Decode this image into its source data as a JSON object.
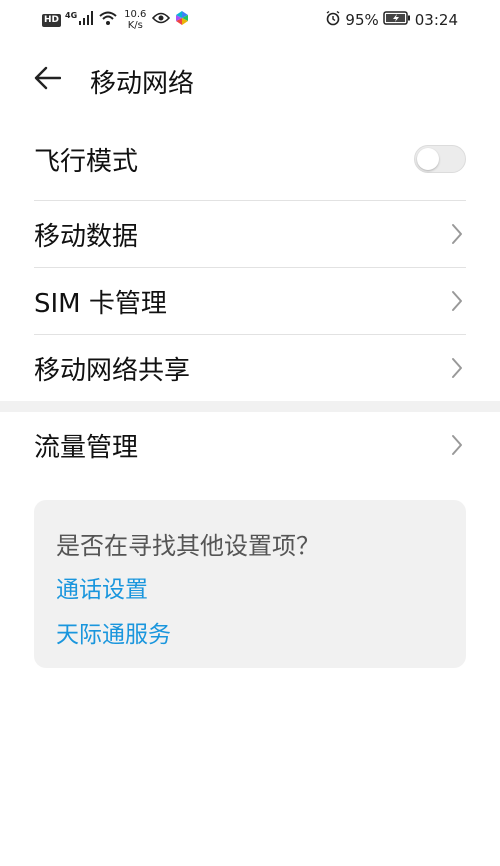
{
  "status_bar": {
    "hd": "HD",
    "network_type": "4G",
    "speed_value": "10.6",
    "speed_unit": "K/s",
    "battery_percent": "95%",
    "time": "03:24"
  },
  "header": {
    "title": "移动网络"
  },
  "settings": {
    "airplane_mode": {
      "label": "飞行模式",
      "enabled": false
    },
    "mobile_data": {
      "label": "移动数据"
    },
    "sim_management": {
      "label": "SIM 卡管理"
    },
    "hotspot": {
      "label": "移动网络共享"
    },
    "data_usage": {
      "label": "流量管理"
    }
  },
  "suggestions": {
    "title": "是否在寻找其他设置项？",
    "links": [
      "通话设置",
      "天际通服务"
    ]
  },
  "colors": {
    "link": "#1a96dd",
    "card_bg": "#f1f1f1",
    "divider": "#e2e2e2"
  }
}
